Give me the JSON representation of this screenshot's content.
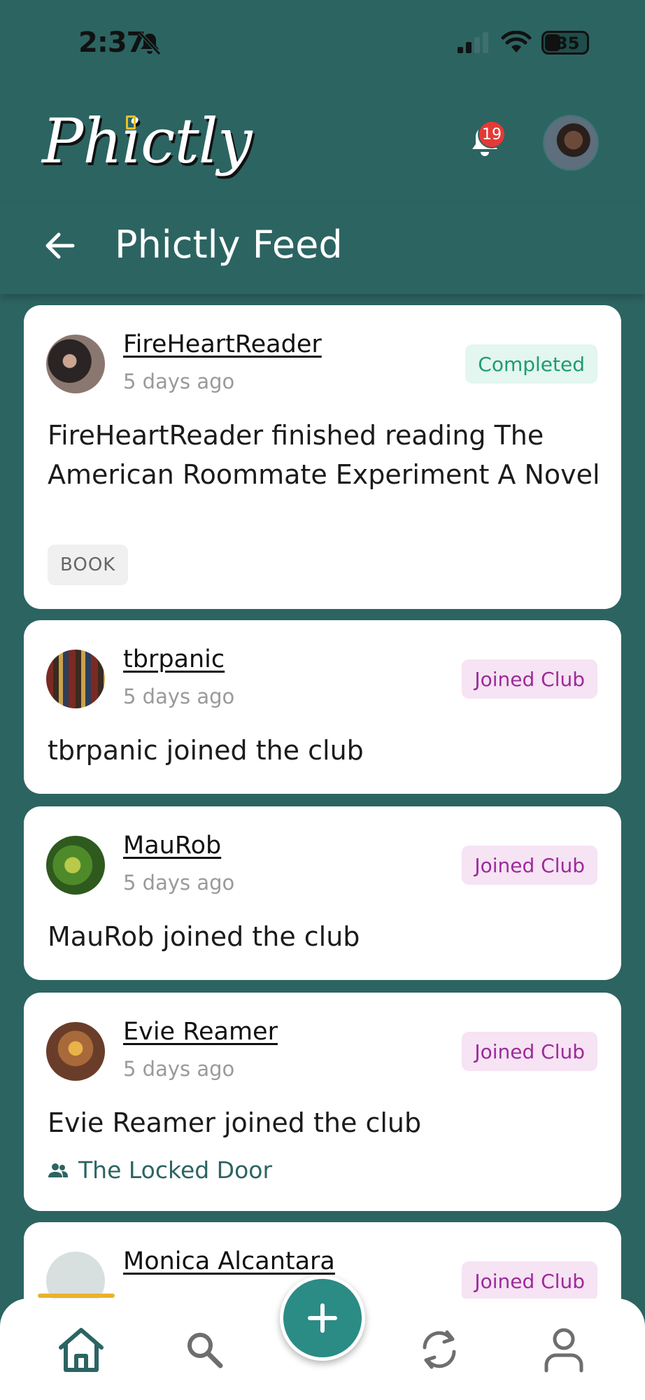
{
  "status_bar": {
    "time": "2:37",
    "battery": "35"
  },
  "header": {
    "logo_text": "Phictly",
    "notification_count": "19",
    "page_title": "Phictly Feed"
  },
  "feed": [
    {
      "user": "FireHeartReader",
      "time": "5 days ago",
      "badge": "Completed",
      "text": "FireHeartReader finished reading The American Roommate Experiment A Novel",
      "tag": "BOOK"
    },
    {
      "user": "tbrpanic",
      "time": "5 days ago",
      "badge": "Joined Club",
      "text": "tbrpanic joined the club"
    },
    {
      "user": "MauRob",
      "time": "5 days ago",
      "badge": "Joined Club",
      "text": "MauRob joined the club"
    },
    {
      "user": "Evie Reamer",
      "time": "5 days ago",
      "badge": "Joined Club",
      "text": "Evie Reamer joined the club",
      "club": "The Locked Door"
    },
    {
      "user": "Monica Alcantara",
      "badge": "Joined Club"
    }
  ],
  "colors": {
    "brand": "#2c6462",
    "fab": "#2a8c85",
    "completed_text": "#1f9b72",
    "joined_text": "#9b2b9a",
    "home_accent": "#e9b22d"
  },
  "icons": {
    "status": [
      "bell-off-icon",
      "signal-icon",
      "wifi-icon",
      "battery-icon"
    ],
    "header": [
      "bell-icon",
      "back-arrow-icon"
    ],
    "nav": [
      "home-icon",
      "search-icon",
      "add-icon",
      "refresh-icon",
      "profile-icon"
    ]
  }
}
